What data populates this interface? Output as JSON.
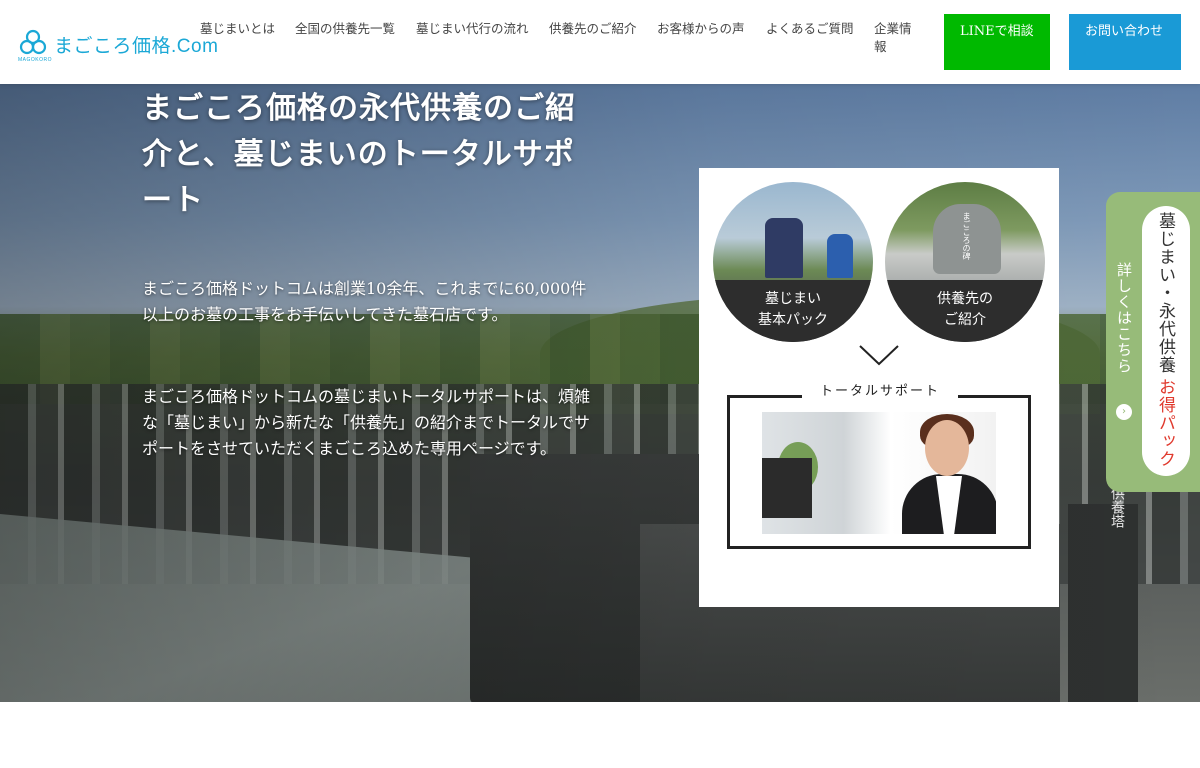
{
  "header": {
    "logo_text": "まごころ価格.Com",
    "logo_sub": "MAGOKORO",
    "nav": [
      "墓じまいとは",
      "全国の供養先一覧",
      "墓じまい代行の流れ",
      "供養先のご紹介",
      "お客様からの声",
      "よくあるご質問",
      "企業情報"
    ],
    "line_button": "LINEで相談",
    "contact_button": "お問い合わせ"
  },
  "hero": {
    "title": "まごころ価格の永代供養のご紹介と、墓じまいのトータルサポート",
    "paragraph1": "まごころ価格ドットコムは創業10余年、これまでに60,000件以上のお墓の工事をお手伝いしてきた墓石店です。",
    "paragraph2": "まごころ価格ドットコムの墓じまいトータルサポートは、煩雑な「墓じまい」から新たな「供養先」の紹介までトータルでサポートをさせていただくまごころ込めた専用ページです。",
    "stone_text": "有縁無縁供養塔"
  },
  "card": {
    "circle1_label": "墓じまい\n基本パック",
    "circle2_label": "供養先の\nご紹介",
    "stone_inscription": "まごころの碑",
    "total_label": "トータルサポート"
  },
  "side_tab": {
    "line1": "墓じまい・永代供養",
    "line2": "お得パック",
    "link": "詳しくはこちら"
  },
  "colors": {
    "brand": "#1ba8d6",
    "line_green": "#00b900",
    "contact_blue": "#1a9ad6",
    "side_green": "#97bb79",
    "accent_red": "#e03a2e"
  }
}
